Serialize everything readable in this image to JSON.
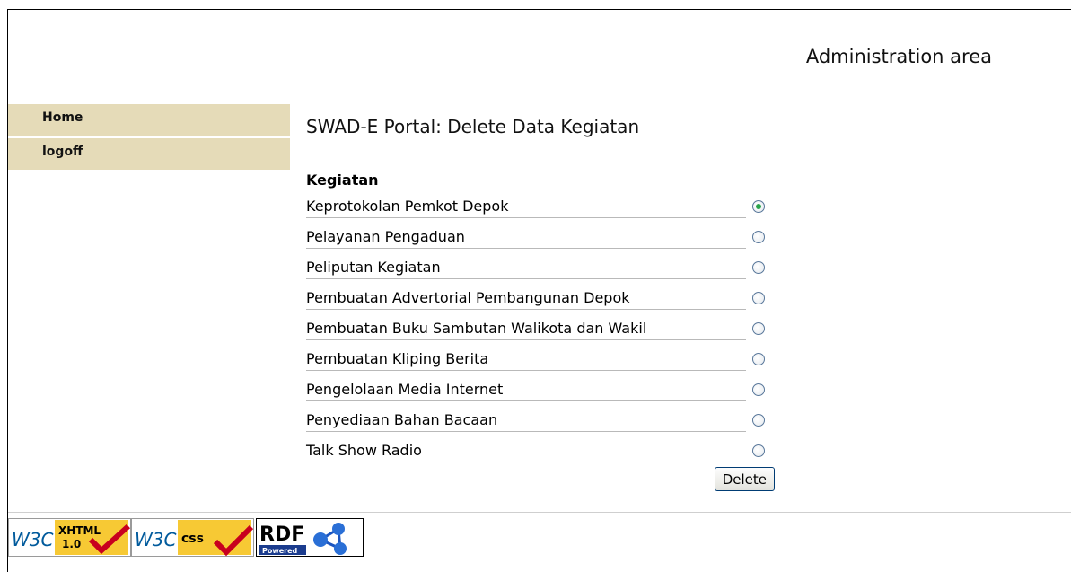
{
  "header": {
    "title": "Administration area"
  },
  "nav": {
    "items": [
      {
        "label": "Home"
      },
      {
        "label": "logoff"
      }
    ]
  },
  "page": {
    "title": "SWAD-E Portal: Delete Data Kegiatan"
  },
  "form": {
    "column_header": "Kegiatan",
    "rows": [
      {
        "label": "Keprotokolan Pemkot Depok",
        "selected": true
      },
      {
        "label": "Pelayanan Pengaduan",
        "selected": false
      },
      {
        "label": "Peliputan Kegiatan",
        "selected": false
      },
      {
        "label": "Pembuatan Advertorial Pembangunan Depok",
        "selected": false
      },
      {
        "label": "Pembuatan Buku Sambutan Walikota dan Wakil",
        "selected": false
      },
      {
        "label": "Pembuatan Kliping Berita",
        "selected": false
      },
      {
        "label": "Pengelolaan Media Internet",
        "selected": false
      },
      {
        "label": "Penyediaan Bahan Bacaan",
        "selected": false
      },
      {
        "label": "Talk Show Radio",
        "selected": false
      }
    ],
    "delete_label": "Delete"
  },
  "badges": {
    "xhtml": {
      "w3c": "W3C",
      "top": "XHTML",
      "bottom": "1.0"
    },
    "css": {
      "w3c": "W3C",
      "text": "css"
    },
    "rdf": {
      "text": "RDF",
      "sub": "Powered"
    }
  },
  "colors": {
    "nav_bg": "#e5dbb8",
    "badge_yellow": "#f7c934",
    "badge_check": "#c8001e",
    "w3c_blue": "#005a9c",
    "radio_selected": "#28a34a"
  }
}
